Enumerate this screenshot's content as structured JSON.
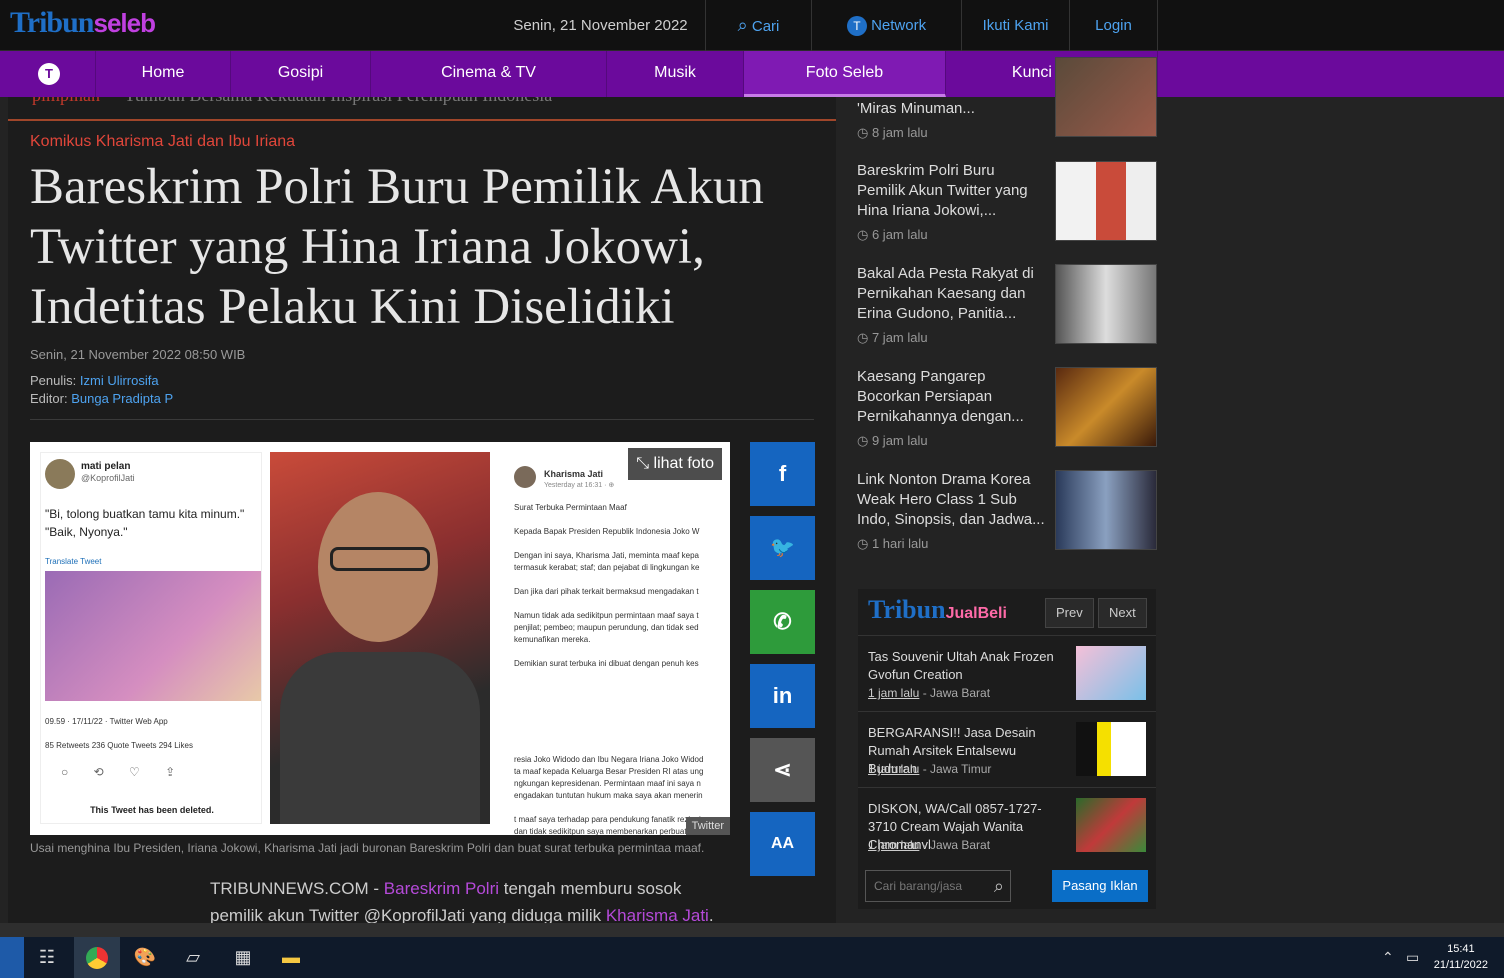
{
  "header": {
    "logo_main": "Tribun",
    "logo_sub": "seleb",
    "date": "Senin, 21 November 2022",
    "links": [
      {
        "label": "Cari",
        "icon": "search-icon"
      },
      {
        "label": "Network",
        "icon": "globe-icon"
      },
      {
        "label": "Ikuti Kami"
      },
      {
        "label": "Login"
      }
    ]
  },
  "nav": {
    "home_icon_glyph": "T",
    "items": [
      "Home",
      "Gosipi",
      "Cinema & TV",
      "Musik",
      "Foto Seleb",
      "Kunci Gitar"
    ],
    "active_index": 4
  },
  "article": {
    "ghost_prefix": "pimpinan",
    "ghost_text": "Tumbuh Bersama Kekuatan Inspirasi Perempuan Indonesia",
    "kicker": "Komikus Kharisma Jati dan Ibu Iriana",
    "title": "Bareskrim Polri Buru Pemilik Akun Twitter yang Hina Iriana Jokowi, Indetitas Pelaku Kini Diselidiki",
    "published": "Senin, 21 November 2022 08:50 WIB",
    "writer_label": "Penulis:",
    "writer": "Izmi Ulirrosifa",
    "editor_label": "Editor:",
    "editor": "Bunga Pradipta P",
    "photo": {
      "lihat": "lihat foto",
      "source": "Twitter",
      "tweet": {
        "name": "mati pelan",
        "handle": "@KoprofilJati",
        "text_line1": "\"Bi, tolong buatkan tamu kita minum.\"",
        "text_line2": "\"Baik, Nyonya.\"",
        "translate": "Translate Tweet",
        "time": "09.59 · 17/11/22 · Twitter Web App",
        "stats": "85 Retweets  236 Quote Tweets  294 Likes",
        "icons": "○ ⟲ ♡ ⇪",
        "deleted": "This Tweet has been deleted."
      },
      "letter": {
        "name": "Kharisma Jati",
        "time": "Yesterday at 16:31 · ⊕",
        "body": "Surat Terbuka Permintaan Maaf\n\nKepada Bapak Presiden Republik Indonesia Joko W\n\nDengan ini saya, Kharisma Jati, meminta maaf kepa\ntermasuk kerabat; staf; dan pejabat di lingkungan ke\n\nDan jika dari pihak terkait bermaksud mengadakan t\n\nNamun tidak ada sedikitpun permintaan maaf saya t\npenjilat; pembeo; maupun perundung, dan tidak sed\nkemunafikan mereka.\n\nDemikian surat terbuka ini dibuat dengan penuh kes\n\n\n\n\n\n\n\nresia Joko Widodo dan Ibu Negara Iriana Joko Widod\nta maaf kepada Keluarga Besar Presiden RI atas ung\nngkungan kepresidenan. Permintaan maaf ini saya n\nengadakan tuntutan hukum maka saya akan menerin\n\nt maaf saya terhadap para pendukung fanatik rezim i\ndan tidak sedikitpun saya membenarkan perbuatan se\n\nan penuh kesadaran tanpa paksaan dari pihak manap"
      }
    },
    "caption": "Usai menghina Ibu Presiden, Iriana Jokowi, Kharisma Jati jadi buronan Bareskrim Polri dan buat surat terbuka permintaa maaf.",
    "body_prefix": "TRIBUNNEWS.COM - ",
    "body_link1": "Bareskrim Polri",
    "body_mid": " tengah memburu sosok pemilik akun Twitter @KoprofilJati yang diduga milik ",
    "body_link2": "Kharisma Jati",
    "body_end": "."
  },
  "share": [
    {
      "glyph": "f",
      "name": "facebook",
      "color": "#1565c0"
    },
    {
      "glyph": "🐦",
      "name": "twitter",
      "color": "#1565c0"
    },
    {
      "glyph": "✆",
      "name": "whatsapp",
      "color": "#2e9b3b"
    },
    {
      "glyph": "in",
      "name": "linkedin",
      "color": "#1565c0"
    },
    {
      "glyph": "⋖",
      "name": "share",
      "color": "#555555"
    },
    {
      "glyph": "AA",
      "name": "font-size",
      "color": "#1565c0"
    }
  ],
  "sidebar": {
    "items": [
      {
        "title": "'Miras Minuman...",
        "time": "8 jam lalu"
      },
      {
        "title": "Bareskrim Polri Buru Pemilik Akun Twitter yang Hina Iriana Jokowi,...",
        "time": "6 jam lalu"
      },
      {
        "title": "Bakal Ada Pesta Rakyat di Pernikahan Kaesang dan Erina Gudono, Panitia...",
        "time": "7 jam lalu"
      },
      {
        "title": "Kaesang Pangarep Bocorkan Persiapan Pernikahannya dengan...",
        "time": "9 jam lalu"
      },
      {
        "title": "Link Nonton Drama Korea Weak Hero Class 1 Sub Indo, Sinopsis, dan Jadwa...",
        "time": "1 hari lalu"
      }
    ]
  },
  "jualbeli": {
    "brand_main": "Tribun",
    "brand_sub": "JualBeli",
    "prev": "Prev",
    "next": "Next",
    "items": [
      {
        "title": "Tas Souvenir Ultah Anak Frozen Gvofun Creation",
        "time": "1 jam lalu",
        "region": " - Jawa Barat"
      },
      {
        "title": "BERGARANSI!! Jasa Desain Rumah Arsitek Entalsewu Buduran",
        "time": "1 jam lalu",
        "region": " - Jawa Timur"
      },
      {
        "title": "DISKON, WA/Call 0857-1727-3710 Cream Wajah Wanita Chromanvl",
        "time": "1 jam lalu",
        "region": " - Jawa Barat"
      }
    ],
    "search_placeholder": "Cari barang/jasa",
    "post_ad": "Pasang Iklan"
  },
  "taskbar": {
    "time": "15:41",
    "date": "21/11/2022"
  }
}
